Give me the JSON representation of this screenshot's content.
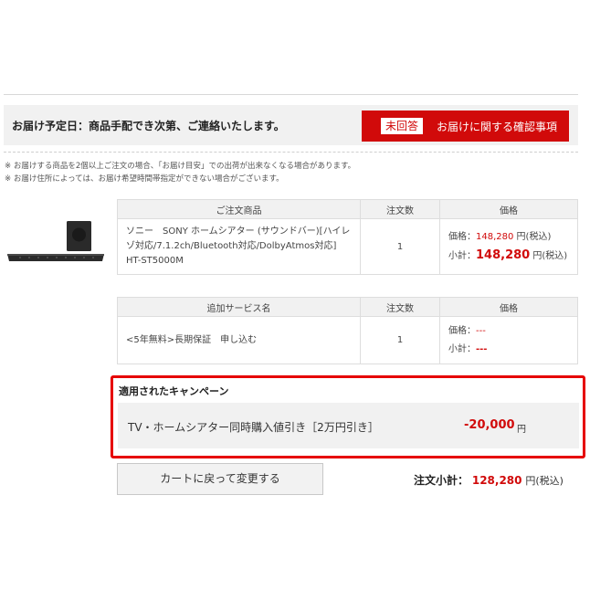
{
  "delivery": {
    "text": "お届け予定日：商品手配でき次第、ご連絡いたします。",
    "badge": "未回答",
    "confirm_label": "お届けに関する確認事項"
  },
  "notes": [
    "※ お届けする商品を2個以上ご注文の場合、「お届け目安」での出荷が出来なくなる場合があります。",
    "※ お届け住所によっては、お届け希望時間帯指定ができない場合がございます。"
  ],
  "order_table": {
    "headers": [
      "ご注文商品",
      "注文数",
      "価格"
    ],
    "product_name": "ソニー　SONY ホームシアター (サウンドバー)[ハイレゾ対応/7.1.2ch/Bluetooth対応/DolbyAtmos対応] HT-ST5000M",
    "quantity": "1",
    "price_label": "価格：",
    "price_value": "148,280",
    "price_unit": "円(税込)",
    "subtotal_label": "小計：",
    "subtotal_value": "148,280",
    "subtotal_unit": "円(税込)"
  },
  "service_table": {
    "headers": [
      "追加サービス名",
      "注文数",
      "価格"
    ],
    "service_name": "<5年無料>長期保証　申し込む",
    "quantity": "1",
    "price_label": "価格：",
    "price_value": "---",
    "subtotal_label": "小計：",
    "subtotal_value": "---"
  },
  "campaign": {
    "title": "適用されたキャンペーン",
    "name": "TV・ホームシアター同時購入値引き［2万円引き］",
    "discount": "-20,000",
    "unit": "円"
  },
  "footer": {
    "back_button": "カートに戻って変更する",
    "total_label": "注文小計：",
    "total_value": "128,280",
    "total_unit": "円(税込)"
  },
  "colors": {
    "accent": "#d10a0a",
    "campaign_border": "#e60000"
  }
}
